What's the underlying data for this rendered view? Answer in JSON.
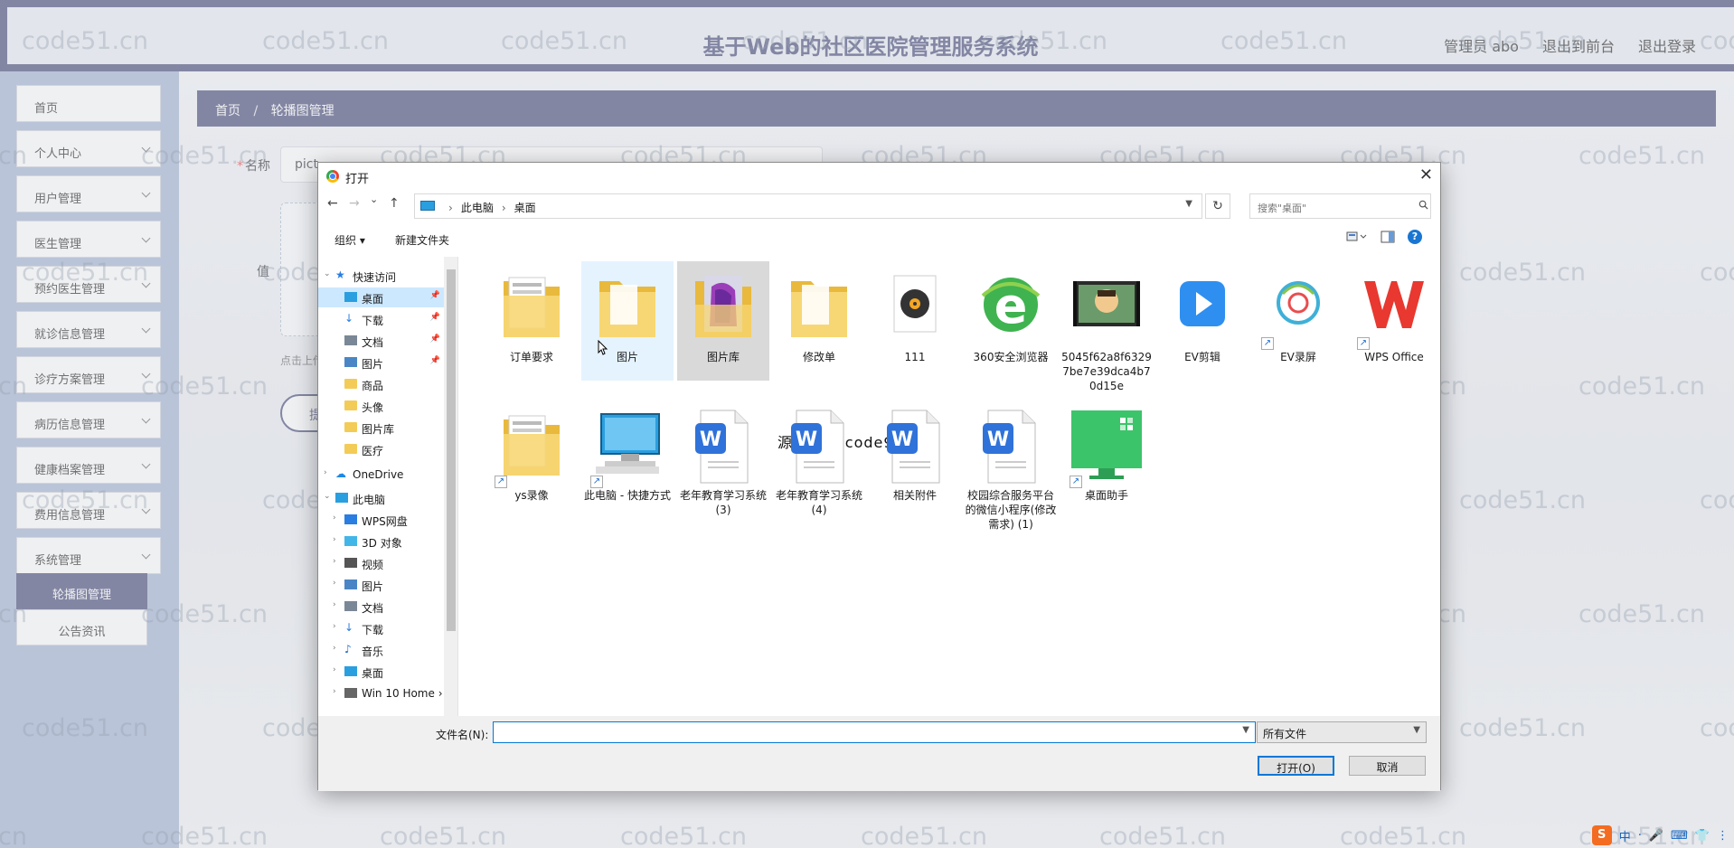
{
  "header": {
    "title": "基于Web的社区医院管理服务系统",
    "links": [
      "管理员 abo",
      "退出到前台",
      "退出登录"
    ]
  },
  "sidebar": {
    "items": [
      {
        "label": "首页",
        "has_chevron": false
      },
      {
        "label": "个人中心",
        "has_chevron": true
      },
      {
        "label": "用户管理",
        "has_chevron": true
      },
      {
        "label": "医生管理",
        "has_chevron": true
      },
      {
        "label": "预约医生管理",
        "has_chevron": true
      },
      {
        "label": "就诊信息管理",
        "has_chevron": true
      },
      {
        "label": "诊疗方案管理",
        "has_chevron": true
      },
      {
        "label": "病历信息管理",
        "has_chevron": true
      },
      {
        "label": "健康档案管理",
        "has_chevron": true
      },
      {
        "label": "费用信息管理",
        "has_chevron": true
      },
      {
        "label": "系统管理",
        "has_chevron": true
      }
    ],
    "sub_items": [
      {
        "label": "轮播图管理",
        "active": true
      },
      {
        "label": "公告资讯",
        "active": false
      }
    ]
  },
  "breadcrumb": {
    "home": "首页",
    "separator": "/",
    "current": "轮播图管理"
  },
  "form": {
    "name_label": "名称",
    "required_mark": "*",
    "name_value": "pict",
    "value_label": "值",
    "upload_tip": "点击上传",
    "submit_label": "提"
  },
  "dialog": {
    "title": "打开",
    "close_glyph": "✕",
    "nav": {
      "back": "←",
      "forward": "→",
      "recent": "⌄",
      "up": "↑"
    },
    "address": [
      "此电脑",
      "桌面"
    ],
    "address_separator": "›",
    "refresh_glyph": "↻",
    "search_placeholder": "搜索\"桌面\"",
    "toolbar": {
      "organize": "组织 ▾",
      "new_folder": "新建文件夹"
    },
    "help_glyph": "?",
    "nav_tree": [
      {
        "label": "快速访问",
        "icon": "star-icon",
        "level": 0,
        "expanded": true,
        "pinned": false,
        "selected": false
      },
      {
        "label": "桌面",
        "icon": "desktop-icon",
        "level": 1,
        "expanded": false,
        "pinned": true,
        "selected": true
      },
      {
        "label": "下载",
        "icon": "download-icon",
        "level": 1,
        "expanded": false,
        "pinned": true,
        "selected": false
      },
      {
        "label": "文档",
        "icon": "document-icon",
        "level": 1,
        "expanded": false,
        "pinned": true,
        "selected": false
      },
      {
        "label": "图片",
        "icon": "picture-icon",
        "level": 1,
        "expanded": false,
        "pinned": true,
        "selected": false
      },
      {
        "label": "商品",
        "icon": "folder-icon",
        "level": 1,
        "expanded": false,
        "pinned": false,
        "selected": false
      },
      {
        "label": "头像",
        "icon": "folder-icon",
        "level": 1,
        "expanded": false,
        "pinned": false,
        "selected": false
      },
      {
        "label": "图片库",
        "icon": "folder-icon",
        "level": 1,
        "expanded": false,
        "pinned": false,
        "selected": false
      },
      {
        "label": "医疗",
        "icon": "folder-icon",
        "level": 1,
        "expanded": false,
        "pinned": false,
        "selected": false
      },
      {
        "label": "OneDrive",
        "icon": "cloud-icon",
        "level": 0,
        "expanded": false,
        "pinned": false,
        "selected": false
      },
      {
        "label": "此电脑",
        "icon": "computer-icon",
        "level": 0,
        "expanded": true,
        "pinned": false,
        "selected": false
      },
      {
        "label": "WPS网盘",
        "icon": "wps-cloud-icon",
        "level": 1,
        "expanded": false,
        "pinned": false,
        "selected": false
      },
      {
        "label": "3D 对象",
        "icon": "3d-object-icon",
        "level": 1,
        "expanded": false,
        "pinned": false,
        "selected": false
      },
      {
        "label": "视频",
        "icon": "video-icon",
        "level": 1,
        "expanded": false,
        "pinned": false,
        "selected": false
      },
      {
        "label": "图片",
        "icon": "picture-icon",
        "level": 1,
        "expanded": false,
        "pinned": false,
        "selected": false
      },
      {
        "label": "文档",
        "icon": "document-icon",
        "level": 1,
        "expanded": false,
        "pinned": false,
        "selected": false
      },
      {
        "label": "下载",
        "icon": "download-icon",
        "level": 1,
        "expanded": false,
        "pinned": false,
        "selected": false
      },
      {
        "label": "音乐",
        "icon": "music-icon",
        "level": 1,
        "expanded": false,
        "pinned": false,
        "selected": false
      },
      {
        "label": "桌面",
        "icon": "desktop-icon",
        "level": 1,
        "expanded": false,
        "pinned": false,
        "selected": false
      },
      {
        "label": "Win 10 Home ›",
        "icon": "drive-icon",
        "level": 1,
        "expanded": false,
        "pinned": false,
        "selected": false
      }
    ],
    "files": [
      {
        "label": "订单要求",
        "icon": "folder-docs-icon",
        "state": ""
      },
      {
        "label": "图片",
        "icon": "folder-icon",
        "state": "hover"
      },
      {
        "label": "图片库",
        "icon": "folder-purple-icon",
        "state": "selected"
      },
      {
        "label": "修改单",
        "icon": "folder-icon",
        "state": ""
      },
      {
        "label": "111",
        "icon": "music-app-icon",
        "state": ""
      },
      {
        "label": "360安全浏览器",
        "icon": "360-browser-icon",
        "state": ""
      },
      {
        "label": "5045f62a8f63297be7e39dca4b70d15e",
        "icon": "video-thumb-icon",
        "state": ""
      },
      {
        "label": "EV剪辑",
        "icon": "ev-clip-icon",
        "state": ""
      },
      {
        "label": "EV录屏",
        "icon": "ev-record-icon",
        "state": ""
      },
      {
        "label": "WPS Office",
        "icon": "wps-office-icon",
        "state": ""
      },
      {
        "label": "ys录像",
        "icon": "folder-docs-icon",
        "state": ""
      },
      {
        "label": "此电脑 - 快捷方式",
        "icon": "computer-icon",
        "state": ""
      },
      {
        "label": "老年教育学习系统 (3)",
        "icon": "word-doc-icon",
        "state": ""
      },
      {
        "label": "老年教育学习系统 (4)",
        "icon": "word-doc-icon",
        "state": ""
      },
      {
        "label": "相关附件",
        "icon": "word-doc-icon",
        "state": ""
      },
      {
        "label": "校园综合服务平台的微信小程序(修改需求) (1)",
        "icon": "word-doc-icon",
        "state": ""
      },
      {
        "label": "桌面助手",
        "icon": "desktop-helper-icon",
        "state": ""
      }
    ],
    "watermark_text": "源码久久-code99.top",
    "filename_label": "文件名(N):",
    "filename_value": "",
    "filetype_value": "所有文件",
    "open_button": "打开(O)",
    "cancel_button": "取消"
  },
  "watermark": "code51.cn",
  "tray_items": [
    "中",
    "·",
    "🎤",
    "⌨",
    "👕",
    "⋮"
  ],
  "tray_logo": "S"
}
